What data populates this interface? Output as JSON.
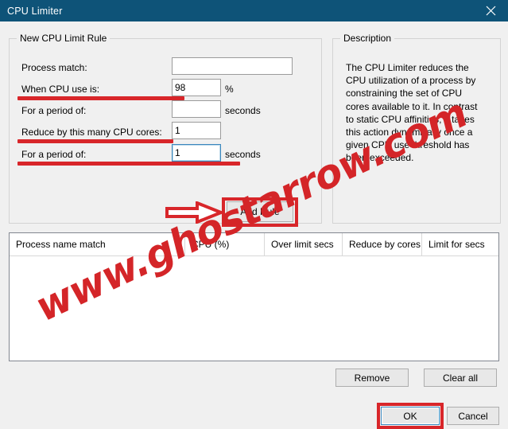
{
  "window": {
    "title": "CPU Limiter",
    "close_icon": "close-icon"
  },
  "groups": {
    "new_rule": {
      "legend": "New CPU Limit Rule"
    },
    "description": {
      "legend": "Description",
      "body": "The CPU Limiter reduces the CPU utilization of a process by constraining the set of CPU cores available to it. In contrast to static CPU affinities, it takes this action dynamically once a given CPU use threshold has been exceeded."
    }
  },
  "form": {
    "process_match": {
      "label": "Process match:",
      "value": "",
      "placeholder": ""
    },
    "cpu_use": {
      "label": "When CPU use is:",
      "value": "98",
      "unit": "%"
    },
    "cpu_period": {
      "label": "For a period of:",
      "value": "",
      "unit": "seconds"
    },
    "reduce_cores": {
      "label": "Reduce by this many CPU cores:",
      "value": "1",
      "unit": ""
    },
    "limit_period": {
      "label": "For a period of:",
      "value": "1",
      "unit": "seconds"
    },
    "add_rule_label": "Add Rule"
  },
  "listview": {
    "columns": [
      "Process name match",
      "CPU (%)",
      "Over limit secs",
      "Reduce by cores",
      "Limit for secs"
    ],
    "rows": []
  },
  "buttons": {
    "remove": "Remove",
    "clear_all": "Clear all",
    "ok": "OK",
    "cancel": "Cancel"
  },
  "watermark": {
    "text": "www.ghostarrow.com"
  },
  "colors": {
    "titlebar": "#0e5378",
    "annotation_red": "#d8262a",
    "watermark_red": "#d42528",
    "focus_blue": "#3b87bd",
    "dialog_bg": "#f0f0f0"
  }
}
